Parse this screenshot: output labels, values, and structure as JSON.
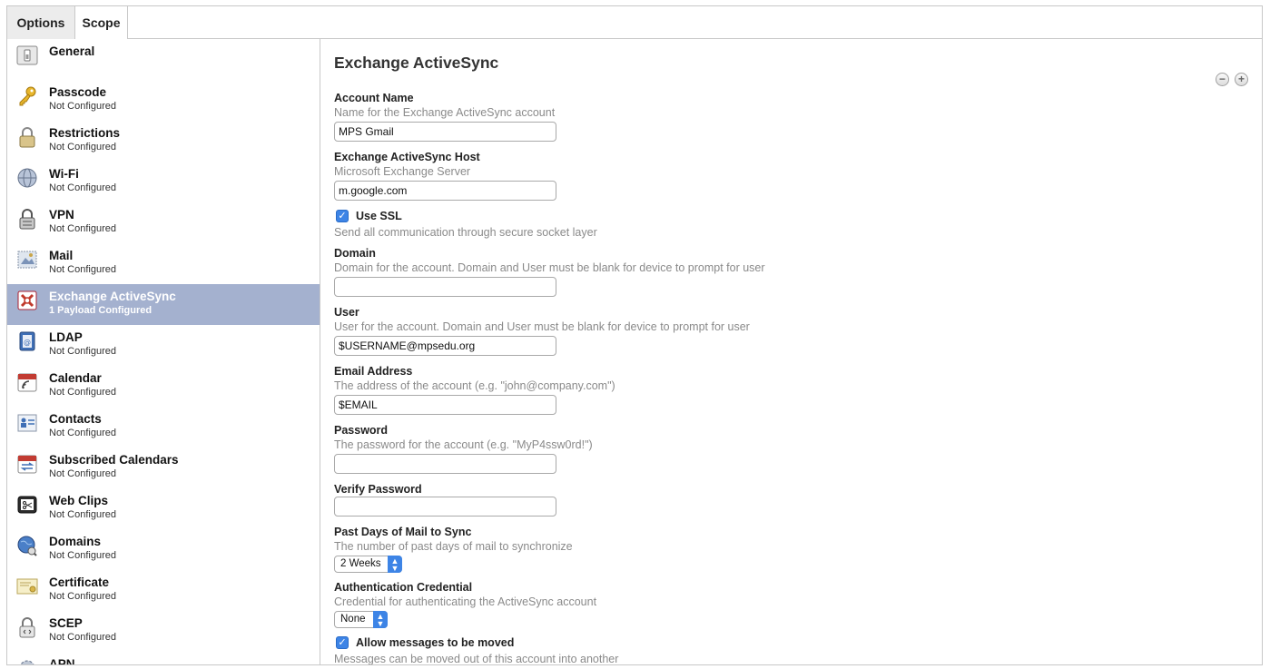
{
  "tabs": {
    "options": "Options",
    "scope": "Scope"
  },
  "sidebar": {
    "items": [
      {
        "name": "General",
        "status": "",
        "icon": "general-switch-icon"
      },
      {
        "name": "Passcode",
        "status": "Not Configured",
        "icon": "key-icon"
      },
      {
        "name": "Restrictions",
        "status": "Not Configured",
        "icon": "padlock-icon"
      },
      {
        "name": "Wi-Fi",
        "status": "Not Configured",
        "icon": "globe-wifi-icon"
      },
      {
        "name": "VPN",
        "status": "Not Configured",
        "icon": "vpn-lock-icon"
      },
      {
        "name": "Mail",
        "status": "Not Configured",
        "icon": "mail-stamp-icon"
      },
      {
        "name": "Exchange ActiveSync",
        "status": "1 Payload Configured",
        "icon": "exchange-icon"
      },
      {
        "name": "LDAP",
        "status": "Not Configured",
        "icon": "address-book-icon"
      },
      {
        "name": "Calendar",
        "status": "Not Configured",
        "icon": "calendar-icon"
      },
      {
        "name": "Contacts",
        "status": "Not Configured",
        "icon": "contacts-icon"
      },
      {
        "name": "Subscribed Calendars",
        "status": "Not Configured",
        "icon": "subscribed-calendar-icon"
      },
      {
        "name": "Web Clips",
        "status": "Not Configured",
        "icon": "web-clip-icon"
      },
      {
        "name": "Domains",
        "status": "Not Configured",
        "icon": "domains-globe-icon"
      },
      {
        "name": "Certificate",
        "status": "Not Configured",
        "icon": "certificate-icon"
      },
      {
        "name": "SCEP",
        "status": "Not Configured",
        "icon": "scep-lock-icon"
      },
      {
        "name": "APN",
        "status": "",
        "icon": "apn-gear-icon"
      }
    ]
  },
  "main": {
    "title": "Exchange ActiveSync",
    "remove_button": "−",
    "add_button": "+",
    "account_name": {
      "label": "Account Name",
      "description": "Name for the Exchange ActiveSync account",
      "value": "MPS Gmail"
    },
    "host": {
      "label": "Exchange ActiveSync Host",
      "description": "Microsoft Exchange Server",
      "value": "m.google.com"
    },
    "use_ssl": {
      "label": "Use SSL",
      "description": "Send all communication through secure socket layer",
      "checked": true
    },
    "domain": {
      "label": "Domain",
      "description": "Domain for the account. Domain and User must be blank for device to prompt for user",
      "value": ""
    },
    "user": {
      "label": "User",
      "description": "User for the account. Domain and User must be blank for device to prompt for user",
      "value": "$USERNAME@mpsedu.org"
    },
    "email": {
      "label": "Email Address",
      "description": "The address of the account (e.g. \"john@company.com\")",
      "value": "$EMAIL"
    },
    "password": {
      "label": "Password",
      "description": "The password for the account (e.g. \"MyP4ssw0rd!\")",
      "value": ""
    },
    "verify_password": {
      "label": "Verify Password",
      "value": ""
    },
    "past_days": {
      "label": "Past Days of Mail to Sync",
      "description": "The number of past days of mail to synchronize",
      "selected": "2 Weeks"
    },
    "auth_credential": {
      "label": "Authentication Credential",
      "description": "Credential for authenticating the ActiveSync account",
      "selected": "None"
    },
    "allow_move": {
      "label": "Allow messages to be moved",
      "description": "Messages can be moved out of this account into another",
      "checked": true
    }
  },
  "colors": {
    "selection": "#a4b1cf",
    "accent_blue": "#3d84e6",
    "desc_gray": "#8a8a8a"
  }
}
